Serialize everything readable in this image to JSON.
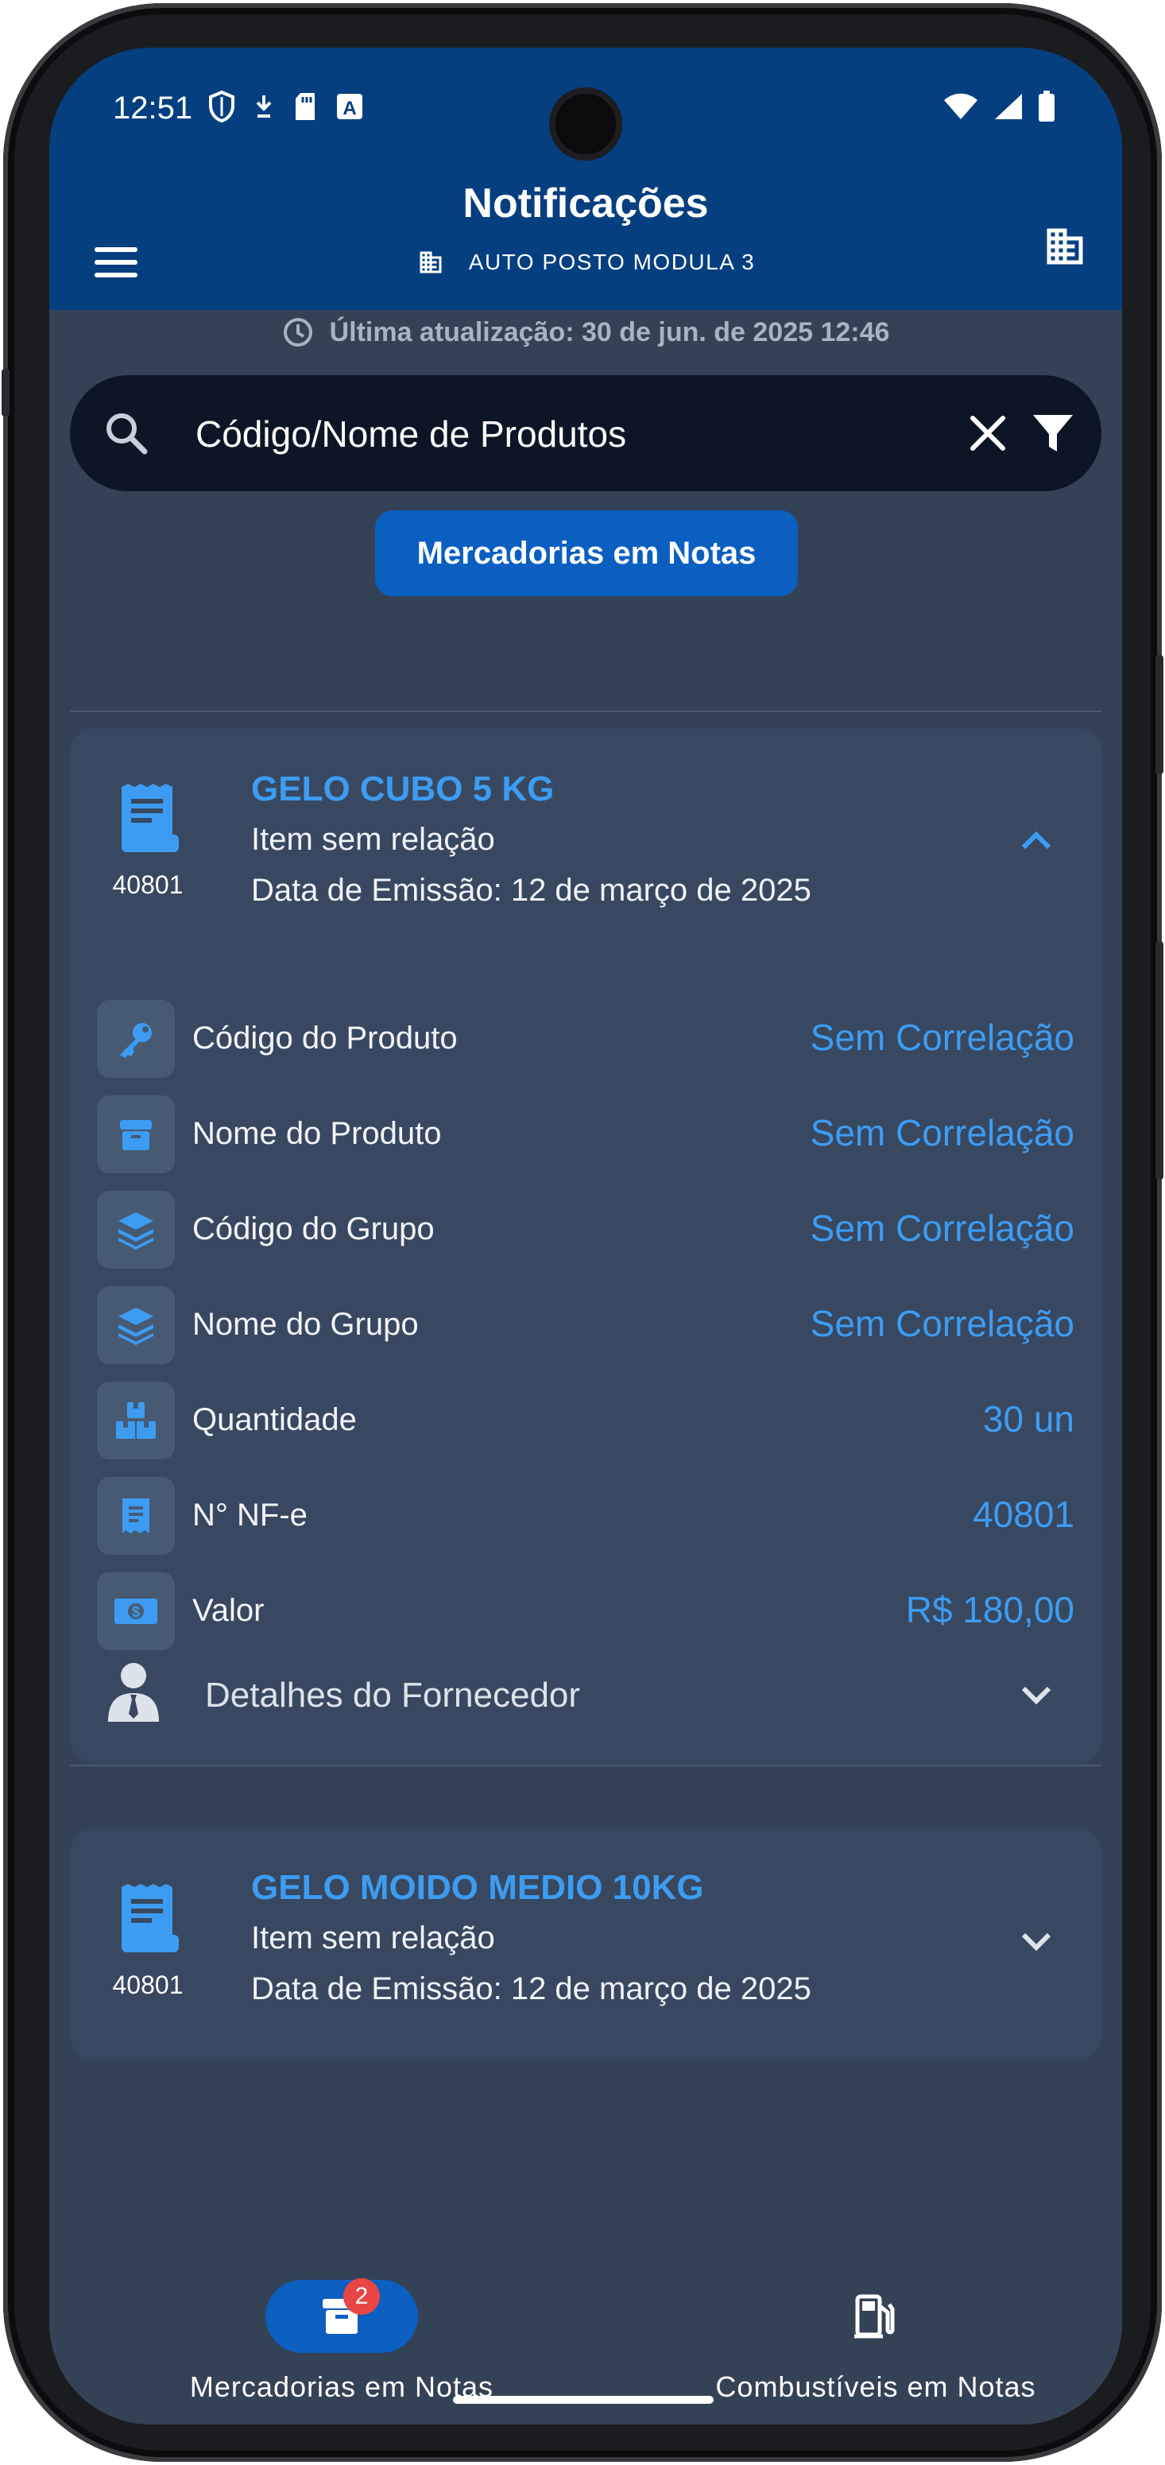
{
  "status_bar": {
    "time": "12:51"
  },
  "header": {
    "title": "Notificações",
    "company": "AUTO POSTO MODULA 3"
  },
  "last_update": "Última atualização: 30 de jun. de 2025 12:46",
  "search": {
    "placeholder": "Código/Nome de Produtos",
    "value": ""
  },
  "filter_chip": "Mercadorias em Notas",
  "cards": [
    {
      "code": "40801",
      "title": "GELO CUBO 5 KG",
      "status": "Item sem relação",
      "date": "Data de Emissão: 12 de março de 2025",
      "expanded": true,
      "rows": [
        {
          "label": "Código do Produto",
          "value": "Sem Correlação",
          "icon": "key-icon"
        },
        {
          "label": "Nome do Produto",
          "value": "Sem Correlação",
          "icon": "box-icon"
        },
        {
          "label": "Código do Grupo",
          "value": "Sem Correlação",
          "icon": "layers-icon"
        },
        {
          "label": "Nome do Grupo",
          "value": "Sem Correlação",
          "icon": "layers-icon"
        },
        {
          "label": "Quantidade",
          "value": "30 un",
          "icon": "boxes-icon"
        },
        {
          "label": "N° NF-e",
          "value": "40801",
          "icon": "receipt-icon"
        },
        {
          "label": "Valor",
          "value": "R$ 180,00",
          "icon": "money-icon"
        }
      ],
      "supplier_label": "Detalhes do Fornecedor"
    },
    {
      "code": "40801",
      "title": "GELO MOIDO MEDIO 10KG",
      "status": "Item sem relação",
      "date": "Data de Emissão: 12 de março de 2025",
      "expanded": false
    }
  ],
  "bottom_nav": [
    {
      "label": "Mercadorias em Notas",
      "badge": "2",
      "active": true
    },
    {
      "label": "Combustíveis em Notas",
      "active": false
    }
  ],
  "colors": {
    "header": "#053f80",
    "background": "#344256",
    "card": "#384860",
    "accent": "#3d9cf2",
    "chip": "#0a5fc0",
    "badge": "#e94545"
  }
}
